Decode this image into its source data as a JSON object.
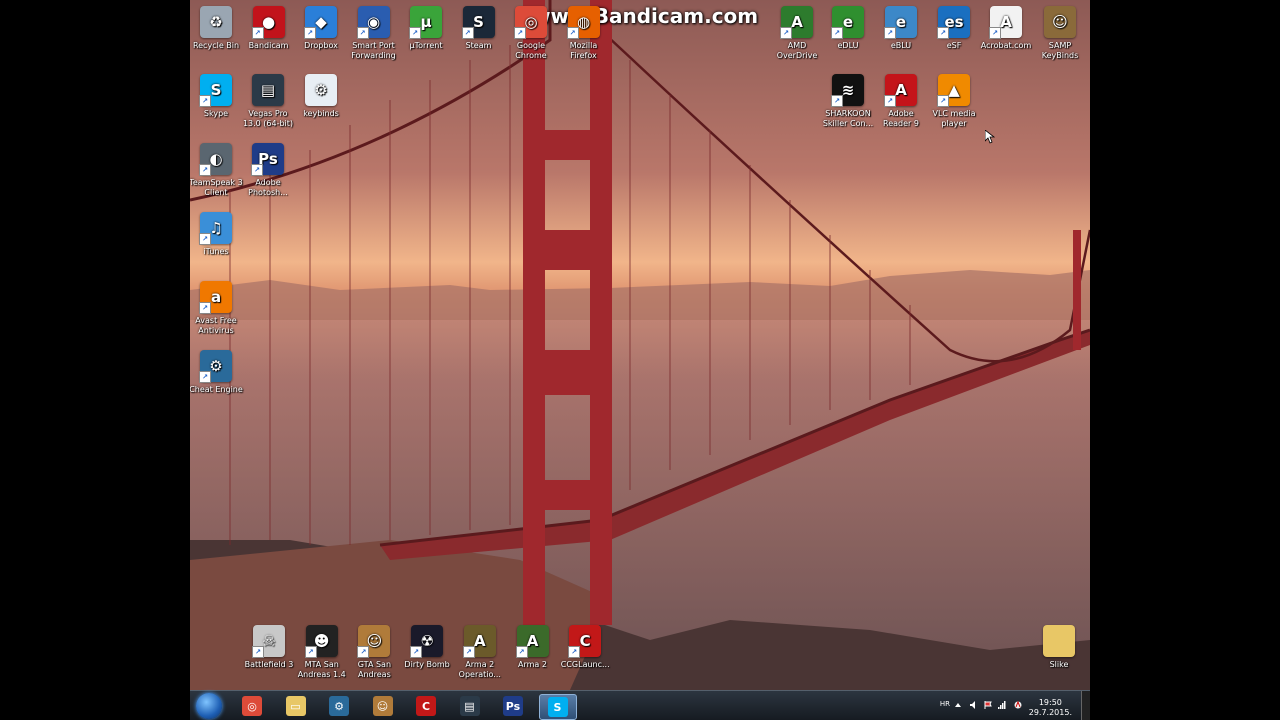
{
  "watermark": "www.Bandicam.com",
  "desktop_icons_left": [
    {
      "id": "recycle-bin",
      "label": "Recycle Bin",
      "icon": "recycle-bin-icon",
      "color": "#9aa6b2",
      "glyph": "♻",
      "shortcut": false
    },
    {
      "id": "bandicam",
      "label": "Bandicam",
      "icon": "bandicam-icon",
      "color": "#c2131b",
      "glyph": "●",
      "shortcut": true
    },
    {
      "id": "dropbox",
      "label": "Dropbox",
      "icon": "dropbox-icon",
      "color": "#2a7fd9",
      "glyph": "◆",
      "shortcut": true
    },
    {
      "id": "smart-port-forwarding",
      "label": "Smart Port\nForwarding",
      "icon": "globe-icon",
      "color": "#2a5db0",
      "glyph": "◉",
      "shortcut": true
    },
    {
      "id": "utorrent",
      "label": "µTorrent",
      "icon": "utorrent-icon",
      "color": "#3aa43a",
      "glyph": "µ",
      "shortcut": true
    },
    {
      "id": "steam",
      "label": "Steam",
      "icon": "steam-icon",
      "color": "#1b2838",
      "glyph": "S",
      "shortcut": true
    },
    {
      "id": "google-chrome",
      "label": "Google\nChrome",
      "icon": "chrome-icon",
      "color": "#dd4b39",
      "glyph": "◎",
      "shortcut": true
    },
    {
      "id": "mozilla-firefox",
      "label": "Mozilla\nFirefox",
      "icon": "firefox-icon",
      "color": "#e66000",
      "glyph": "◍",
      "shortcut": true
    }
  ],
  "desktop_icons_right": [
    {
      "id": "amd-overdrive",
      "label": "AMD\nOverDrive",
      "icon": "amd-icon",
      "color": "#2d7b2d",
      "glyph": "A",
      "shortcut": true
    },
    {
      "id": "edlu",
      "label": "eDLU",
      "icon": "edlu-icon",
      "color": "#2f8f2f",
      "glyph": "e",
      "shortcut": true
    },
    {
      "id": "eblu",
      "label": "eBLU",
      "icon": "eblu-icon",
      "color": "#3c88c8",
      "glyph": "e",
      "shortcut": true
    },
    {
      "id": "esf",
      "label": "eSF",
      "icon": "esf-icon",
      "color": "#1a6fc0",
      "glyph": "es",
      "shortcut": true
    },
    {
      "id": "acrobat-com",
      "label": "Acrobat.com",
      "icon": "acrobat-icon",
      "color": "#f2f2f2",
      "glyph": "A",
      "shortcut": true
    },
    {
      "id": "samp-keybinds",
      "label": "SAMP\nKeyBinds",
      "icon": "samp-icon",
      "color": "#8a6a3a",
      "glyph": "☺",
      "shortcut": false
    }
  ],
  "desktop_icons_row2_right": [
    {
      "id": "sharkoon",
      "label": "SHARKOON\nSkiller Con...",
      "icon": "sharkoon-icon",
      "color": "#111111",
      "glyph": "≋",
      "shortcut": true
    },
    {
      "id": "adobe-reader",
      "label": "Adobe\nReader 9",
      "icon": "adobe-reader-icon",
      "color": "#c4141a",
      "glyph": "A",
      "shortcut": true
    },
    {
      "id": "vlc",
      "label": "VLC media\nplayer",
      "icon": "vlc-icon",
      "color": "#f08a00",
      "glyph": "▲",
      "shortcut": true
    }
  ],
  "desktop_icons_col": [
    {
      "id": "skype",
      "label": "Skype",
      "icon": "skype-icon",
      "color": "#00aff0",
      "glyph": "S",
      "shortcut": true
    },
    {
      "id": "teamspeak",
      "label": "TeamSpeak 3\nClient",
      "icon": "teamspeak-icon",
      "color": "#5a6670",
      "glyph": "◐",
      "shortcut": true
    },
    {
      "id": "itunes",
      "label": "iTunes",
      "icon": "itunes-icon",
      "color": "#3a8fd8",
      "glyph": "♫",
      "shortcut": true
    },
    {
      "id": "avast",
      "label": "Avast Free\nAntivirus",
      "icon": "avast-icon",
      "color": "#f07800",
      "glyph": "a",
      "shortcut": true
    },
    {
      "id": "cheat-engine",
      "label": "Cheat Engine",
      "icon": "cheat-engine-icon",
      "color": "#2a6a9a",
      "glyph": "⚙",
      "shortcut": true
    }
  ],
  "desktop_icons_col2": [
    {
      "id": "vegas-pro",
      "label": "Vegas Pro\n13.0 (64-bit)",
      "icon": "vegas-icon",
      "color": "#2b3a48",
      "glyph": "▤",
      "shortcut": false
    },
    {
      "id": "photoshop",
      "label": "Adobe\nPhotosh...",
      "icon": "photoshop-icon",
      "color": "#1f3c88",
      "glyph": "Ps",
      "shortcut": true
    }
  ],
  "keybinds": {
    "id": "keybinds",
    "label": "keybinds",
    "icon": "config-file-icon",
    "color": "#e8eef4",
    "glyph": "⚙",
    "shortcut": false
  },
  "desktop_icons_bottom": [
    {
      "id": "battlefield3",
      "label": "Battlefield 3",
      "icon": "battlefield-icon",
      "color": "#c8c8c8",
      "glyph": "☠",
      "shortcut": true
    },
    {
      "id": "mta-sa",
      "label": "MTA San\nAndreas 1.4",
      "icon": "mta-icon",
      "color": "#222222",
      "glyph": "☻",
      "shortcut": true
    },
    {
      "id": "gta-sa",
      "label": "GTA San\nAndreas",
      "icon": "gta-icon",
      "color": "#b07b3a",
      "glyph": "☺",
      "shortcut": true
    },
    {
      "id": "dirty-bomb",
      "label": "Dirty Bomb",
      "icon": "dirty-bomb-icon",
      "color": "#1a1a2a",
      "glyph": "☢",
      "shortcut": true
    },
    {
      "id": "arma2-oa",
      "label": "Arma 2\nOperatio...",
      "icon": "arma-icon",
      "color": "#6b5a2a",
      "glyph": "A",
      "shortcut": true
    },
    {
      "id": "arma2",
      "label": "Arma 2",
      "icon": "arma-icon",
      "color": "#3b6a2a",
      "glyph": "A",
      "shortcut": true
    },
    {
      "id": "ccglauncher",
      "label": "CCGLaunc...",
      "icon": "ccg-icon",
      "color": "#c21818",
      "glyph": "C",
      "shortcut": true
    }
  ],
  "slike": {
    "id": "slike",
    "label": "Slike",
    "icon": "folder-icon",
    "color": "#e8c766",
    "glyph": "",
    "shortcut": false
  },
  "taskbar": {
    "pinned": [
      {
        "id": "chrome",
        "icon": "chrome-icon",
        "color": "#dd4b39",
        "glyph": "◎",
        "active": false
      },
      {
        "id": "explorer",
        "icon": "folder-icon",
        "color": "#e8c766",
        "glyph": "▭",
        "active": false
      },
      {
        "id": "cheat-engine",
        "icon": "cheat-engine-icon",
        "color": "#2a6a9a",
        "glyph": "⚙",
        "active": false
      },
      {
        "id": "gta",
        "icon": "gta-icon",
        "color": "#b07b3a",
        "glyph": "☺",
        "active": false
      },
      {
        "id": "ccg",
        "icon": "ccg-icon",
        "color": "#c21818",
        "glyph": "C",
        "active": false
      },
      {
        "id": "vegas",
        "icon": "vegas-icon",
        "color": "#2b3a48",
        "glyph": "▤",
        "active": false
      },
      {
        "id": "photoshop",
        "icon": "photoshop-icon",
        "color": "#1f3c88",
        "glyph": "Ps",
        "active": false
      },
      {
        "id": "skype",
        "icon": "skype-icon",
        "color": "#00aff0",
        "glyph": "S",
        "active": true
      }
    ],
    "language": "HR",
    "time": "19:50",
    "date": "29.7.2015."
  }
}
